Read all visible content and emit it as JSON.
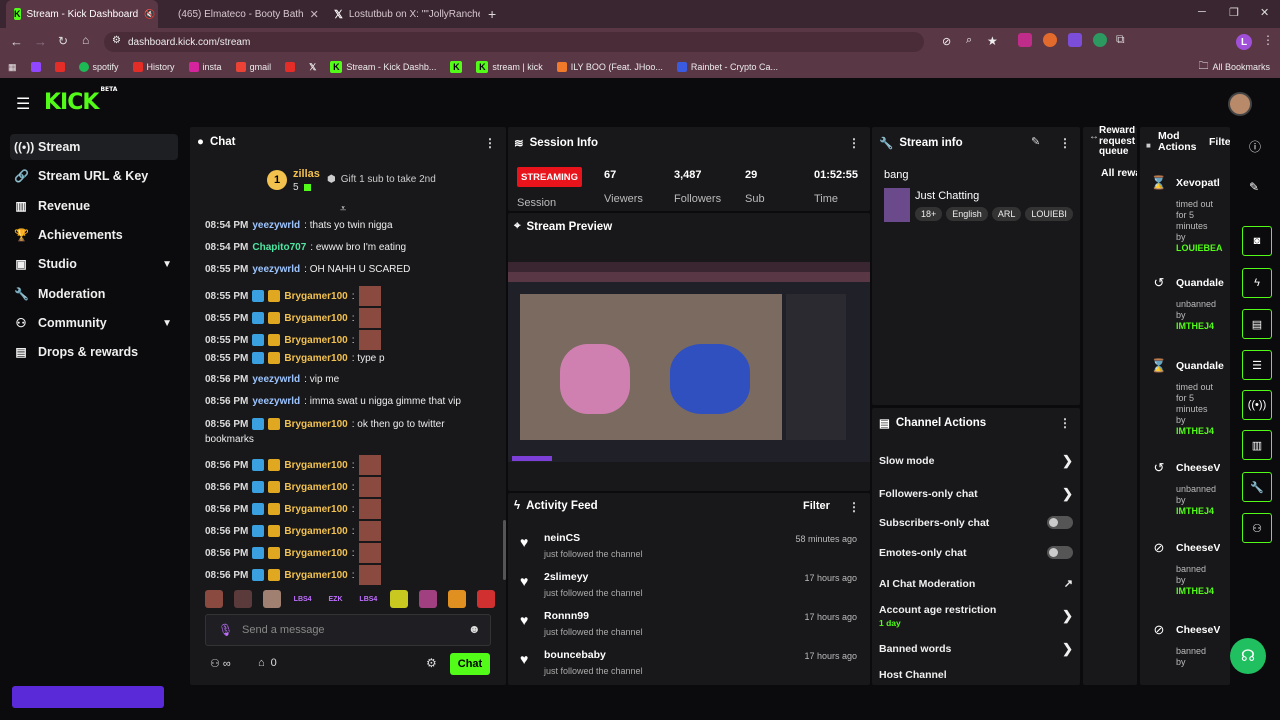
{
  "browser": {
    "tabs": [
      {
        "title": "Stream - Kick Dashboard",
        "active": true
      },
      {
        "title": "(465) Elmateco - Booty Bath"
      },
      {
        "title": "Lostutbub on X: \"\"JollyRanche"
      }
    ],
    "url": "dashboard.kick.com/stream",
    "profile_letter": "L",
    "bookmarks": [
      "spotify",
      "History",
      "insta",
      "gmail",
      "Stream - Kick Dashb...",
      "stream | kick",
      "ILY BOO (Feat. JHoo...",
      "Rainbet - Crypto Ca..."
    ],
    "all_bookmarks": "All Bookmarks"
  },
  "logo": {
    "text": "KICK",
    "beta": "BETA"
  },
  "sidebar": [
    {
      "label": "Stream",
      "icon": "broadcast-icon"
    },
    {
      "label": "Stream URL & Key",
      "icon": "link-icon"
    },
    {
      "label": "Revenue",
      "icon": "chart-icon"
    },
    {
      "label": "Achievements",
      "icon": "trophy-icon"
    },
    {
      "label": "Studio",
      "icon": "studio-icon",
      "expand": true
    },
    {
      "label": "Moderation",
      "icon": "wrench-icon"
    },
    {
      "label": "Community",
      "icon": "community-icon",
      "expand": true
    },
    {
      "label": "Drops & rewards",
      "icon": "drops-icon"
    }
  ],
  "chat": {
    "title": "Chat",
    "gifter": {
      "rank": "1",
      "name": "zillas",
      "count": "5"
    },
    "gift_text": "Gift 1 sub to take 2nd",
    "messages": [
      {
        "time": "08:54 PM",
        "user": "yeezywrld",
        "style": "y",
        "text": ": thats yo twin nigga"
      },
      {
        "time": "08:54 PM",
        "user": "Chapito707",
        "style": "c",
        "text": ": ewww bro I'm eating"
      },
      {
        "time": "08:55 PM",
        "user": "yeezywrld",
        "style": "y",
        "text": ": OH NAHH U SCARED"
      },
      {
        "time": "08:55 PM",
        "user": "Brygamer100",
        "style": "b",
        "text": ":",
        "emote": true
      },
      {
        "time": "08:55 PM",
        "user": "Brygamer100",
        "style": "b",
        "text": ":",
        "emote": true
      },
      {
        "time": "08:55 PM",
        "user": "Brygamer100",
        "style": "b",
        "text": ":",
        "emote": true
      },
      {
        "time": "08:55 PM",
        "user": "Brygamer100",
        "style": "b",
        "text": ": type p"
      },
      {
        "time": "08:56 PM",
        "user": "yeezywrld",
        "style": "y",
        "text": ": vip me"
      },
      {
        "time": "08:56 PM",
        "user": "yeezywrld",
        "style": "y",
        "text": ": imma swat u nigga gimme that vip"
      },
      {
        "time": "08:56 PM",
        "user": "Brygamer100",
        "style": "b",
        "text": ": ok then go to twitter",
        "cont": "bookmarks"
      },
      {
        "time": "08:56 PM",
        "user": "Brygamer100",
        "style": "b",
        "text": ":",
        "emote": true
      },
      {
        "time": "08:56 PM",
        "user": "Brygamer100",
        "style": "b",
        "text": ":",
        "emote": true
      },
      {
        "time": "08:56 PM",
        "user": "Brygamer100",
        "style": "b",
        "text": ":",
        "emote": true
      },
      {
        "time": "08:56 PM",
        "user": "Brygamer100",
        "style": "b",
        "text": ":",
        "emote": true
      },
      {
        "time": "08:56 PM",
        "user": "Brygamer100",
        "style": "b",
        "text": ":",
        "emote": true
      },
      {
        "time": "08:56 PM",
        "user": "Brygamer100",
        "style": "b",
        "text": ":",
        "emote": true
      }
    ],
    "emote_labels": [
      "LBS4",
      "EZK LOUIE",
      "LBS4"
    ],
    "input_placeholder": "Send a message",
    "viewers_count": "0",
    "send_label": "Chat"
  },
  "session": {
    "title": "Session Info",
    "status": "STREAMING",
    "stats": [
      {
        "value": "67",
        "label": "Viewers"
      },
      {
        "value": "3,487",
        "label": "Followers"
      },
      {
        "value": "29",
        "label": "Sub"
      },
      {
        "value": "01:52:55",
        "label": "Time"
      }
    ],
    "session_label": "Session"
  },
  "preview": {
    "title": "Stream Preview"
  },
  "activity": {
    "title": "Activity Feed",
    "filter": "Filter",
    "items": [
      {
        "name": "neinCS",
        "text": "just followed the channel",
        "time": "58 minutes ago"
      },
      {
        "name": "2slimeyy",
        "text": "just followed the channel",
        "time": "17 hours ago"
      },
      {
        "name": "Ronnn99",
        "text": "just followed the channel",
        "time": "17 hours ago"
      },
      {
        "name": "bouncebaby",
        "text": "just followed the channel",
        "time": "17 hours ago"
      }
    ]
  },
  "stream_info": {
    "title": "Stream info",
    "stream_title": "bang",
    "category": "Just Chatting",
    "tags": [
      "18+",
      "English",
      "ARL",
      "LOUIEBI"
    ]
  },
  "channel_actions": {
    "title": "Channel Actions",
    "items": [
      {
        "label": "Slow mode",
        "kind": "arrow"
      },
      {
        "label": "Followers-only chat",
        "kind": "arrow"
      },
      {
        "label": "Subscribers-only chat",
        "kind": "toggle"
      },
      {
        "label": "Emotes-only chat",
        "kind": "toggle"
      },
      {
        "label": "AI Chat Moderation",
        "kind": "external"
      },
      {
        "label": "Account age restriction",
        "kind": "arrow",
        "sub": "1 day"
      },
      {
        "label": "Banned words",
        "kind": "arrow"
      },
      {
        "label": "Host Channel",
        "kind": "none"
      }
    ]
  },
  "reward": {
    "title_lines": [
      "Reward",
      "request",
      "queue"
    ],
    "all": "All rewa"
  },
  "mod_actions": {
    "title_lines": [
      "Mod",
      "Actions"
    ],
    "filter": "Filte",
    "items": [
      {
        "icon": "hourglass-icon",
        "glyph": "⌛",
        "name": "Xevopatl",
        "lines": [
          "timed out",
          "for 5",
          "minutes",
          "by"
        ],
        "by": "LOUIEBEA"
      },
      {
        "icon": "undo-icon",
        "glyph": "↺",
        "name": "Quandale",
        "lines": [
          "unbanned",
          "by"
        ],
        "by": "IMTHEJ4"
      },
      {
        "icon": "hourglass-icon",
        "glyph": "⌛",
        "name": "Quandale",
        "lines": [
          "timed out",
          "for 5",
          "minutes",
          "by"
        ],
        "by": "IMTHEJ4"
      },
      {
        "icon": "undo-icon",
        "glyph": "↺",
        "name": "CheeseV",
        "lines": [
          "unbanned",
          "by"
        ],
        "by": "IMTHEJ4"
      },
      {
        "icon": "ban-icon",
        "glyph": "⊘",
        "name": "CheeseV",
        "lines": [
          "banned",
          "by"
        ],
        "by": "IMTHEJ4"
      },
      {
        "icon": "ban-icon",
        "glyph": "⊘",
        "name": "CheeseV",
        "lines": [
          "banned",
          "by"
        ],
        "by": ""
      }
    ]
  },
  "colors": {
    "accent": "#53fc18",
    "live": "#e9131b",
    "panel": "#18181b"
  }
}
